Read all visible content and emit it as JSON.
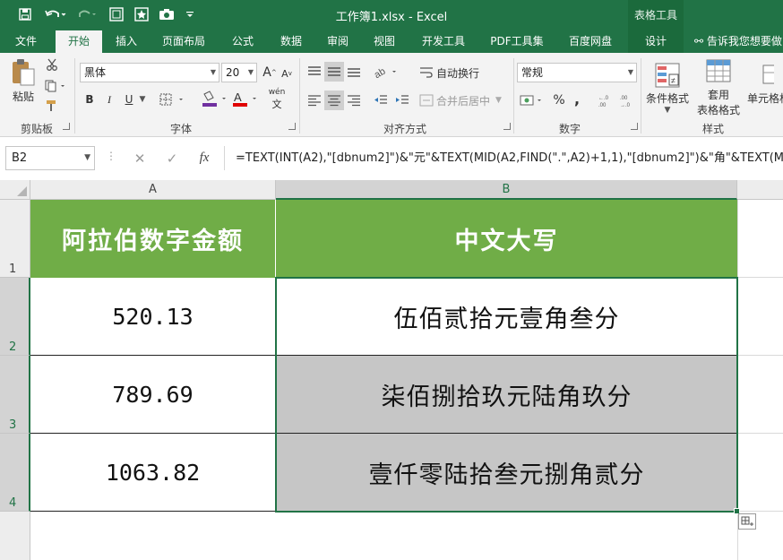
{
  "window": {
    "title": "工作簿1.xlsx - Excel",
    "context_group": "表格工具"
  },
  "tabs": {
    "file": "文件",
    "home": "开始",
    "insert": "插入",
    "page_layout": "页面布局",
    "formulas": "公式",
    "data": "数据",
    "review": "审阅",
    "view": "视图",
    "developer": "开发工具",
    "pdf": "PDF工具集",
    "baidu": "百度网盘",
    "design": "设计",
    "tell_me": "告诉我您想要做"
  },
  "ribbon": {
    "clipboard": {
      "paste": "粘贴",
      "group": "剪贴板"
    },
    "font": {
      "name": "黑体",
      "size": "20",
      "group": "字体",
      "bold": "B",
      "italic": "I",
      "underline": "U",
      "wen": "wén"
    },
    "alignment": {
      "wrap": "自动换行",
      "merge": "合并后居中",
      "group": "对齐方式"
    },
    "number": {
      "format": "常规",
      "percent": "%",
      "comma": ",",
      "group": "数字"
    },
    "styles": {
      "conditional": "条件格式",
      "table_format_1": "套用",
      "table_format_2": "表格格式",
      "cell_styles": "单元格格",
      "group": "样式"
    }
  },
  "formula_bar": {
    "name_box": "B2",
    "fx": "fx",
    "formula": "=TEXT(INT(A2),\"[dbnum2]\")&\"元\"&TEXT(MID(A2,FIND(\".\",A2)+1,1),\"[dbnum2]\")&\"角\"&TEXT(MID("
  },
  "sheet": {
    "columns": [
      "A",
      "B"
    ],
    "rows": [
      "1",
      "2",
      "3",
      "4"
    ],
    "header": [
      "阿拉伯数字金额",
      "中文大写"
    ],
    "data": [
      {
        "amount": "520.13",
        "chinese": "伍佰贰拾元壹角叁分"
      },
      {
        "amount": "789.69",
        "chinese": "柒佰捌拾玖元陆角玖分"
      },
      {
        "amount": "1063.82",
        "chinese": "壹仟零陆拾叁元捌角贰分"
      }
    ]
  },
  "colors": {
    "excel_green": "#217346",
    "header_fill": "#70ad47",
    "selected_fill": "#c0c0c0"
  }
}
